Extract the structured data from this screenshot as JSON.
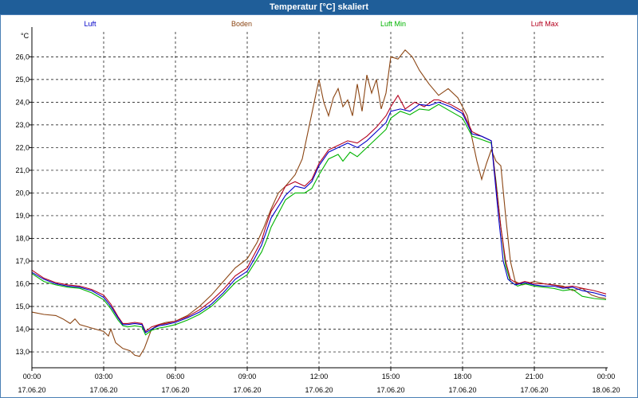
{
  "window": {
    "title": "Temperatur [°C] skaliert"
  },
  "chart_data": {
    "type": "line",
    "title": "Temperatur [°C] skaliert",
    "ylabel": "°C",
    "xlabel": "",
    "ylim": [
      12.3,
      27.1
    ],
    "xlim": [
      0,
      24
    ],
    "grid": true,
    "legend_position": "top",
    "y_ticks": [
      "13,0",
      "14,0",
      "15,0",
      "16,0",
      "17,0",
      "18,0",
      "19,0",
      "20,0",
      "21,0",
      "22,0",
      "23,0",
      "24,0",
      "25,0",
      "26,0"
    ],
    "x_ticks": [
      {
        "time": "00:00",
        "date": "17.06.20"
      },
      {
        "time": "03:00",
        "date": "17.06.20"
      },
      {
        "time": "06:00",
        "date": "17.06.20"
      },
      {
        "time": "09:00",
        "date": "17.06.20"
      },
      {
        "time": "12:00",
        "date": "17.06.20"
      },
      {
        "time": "15:00",
        "date": "17.06.20"
      },
      {
        "time": "18:00",
        "date": "17.06.20"
      },
      {
        "time": "21:00",
        "date": "17.06.20"
      },
      {
        "time": "00:00",
        "date": "18.06.20"
      }
    ],
    "series": [
      {
        "name": "Luft",
        "color": "#0000c8",
        "points": [
          [
            0,
            16.5
          ],
          [
            0.5,
            16.2
          ],
          [
            1,
            16.0
          ],
          [
            1.5,
            15.9
          ],
          [
            2,
            15.85
          ],
          [
            2.5,
            15.7
          ],
          [
            3,
            15.4
          ],
          [
            3.3,
            15.0
          ],
          [
            3.6,
            14.5
          ],
          [
            3.8,
            14.2
          ],
          [
            4,
            14.2
          ],
          [
            4.3,
            14.25
          ],
          [
            4.6,
            14.2
          ],
          [
            4.75,
            13.85
          ],
          [
            5,
            14.0
          ],
          [
            5.3,
            14.15
          ],
          [
            5.6,
            14.2
          ],
          [
            6,
            14.3
          ],
          [
            6.5,
            14.5
          ],
          [
            7,
            14.75
          ],
          [
            7.5,
            15.1
          ],
          [
            8,
            15.6
          ],
          [
            8.5,
            16.2
          ],
          [
            9,
            16.55
          ],
          [
            9.3,
            17.1
          ],
          [
            9.6,
            17.7
          ],
          [
            9.8,
            18.3
          ],
          [
            10,
            18.9
          ],
          [
            10.3,
            19.4
          ],
          [
            10.6,
            19.9
          ],
          [
            11,
            20.3
          ],
          [
            11.4,
            20.2
          ],
          [
            11.7,
            20.5
          ],
          [
            12,
            21.2
          ],
          [
            12.4,
            21.8
          ],
          [
            12.8,
            22.0
          ],
          [
            13.2,
            22.2
          ],
          [
            13.6,
            22.0
          ],
          [
            14,
            22.3
          ],
          [
            14.4,
            22.7
          ],
          [
            14.8,
            23.1
          ],
          [
            15,
            23.6
          ],
          [
            15.4,
            23.7
          ],
          [
            15.8,
            23.6
          ],
          [
            16.2,
            23.9
          ],
          [
            16.6,
            23.85
          ],
          [
            17,
            24.0
          ],
          [
            17.5,
            23.8
          ],
          [
            18,
            23.5
          ],
          [
            18.4,
            22.6
          ],
          [
            18.8,
            22.5
          ],
          [
            19.2,
            22.3
          ],
          [
            19.5,
            19.0
          ],
          [
            19.7,
            17.0
          ],
          [
            19.9,
            16.2
          ],
          [
            20.2,
            15.95
          ],
          [
            20.6,
            16.05
          ],
          [
            21,
            15.95
          ],
          [
            21.4,
            15.9
          ],
          [
            21.8,
            15.9
          ],
          [
            22.2,
            15.8
          ],
          [
            22.6,
            15.85
          ],
          [
            23,
            15.7
          ],
          [
            23.5,
            15.6
          ],
          [
            24,
            15.45
          ]
        ]
      },
      {
        "name": "Boden",
        "color": "#8b4513",
        "points": [
          [
            0,
            14.75
          ],
          [
            0.5,
            14.65
          ],
          [
            1,
            14.6
          ],
          [
            1.3,
            14.45
          ],
          [
            1.6,
            14.25
          ],
          [
            1.8,
            14.45
          ],
          [
            2,
            14.2
          ],
          [
            2.5,
            14.05
          ],
          [
            3,
            13.9
          ],
          [
            3.2,
            13.7
          ],
          [
            3.3,
            14.0
          ],
          [
            3.5,
            13.4
          ],
          [
            3.8,
            13.15
          ],
          [
            4.1,
            13.05
          ],
          [
            4.3,
            12.85
          ],
          [
            4.5,
            12.8
          ],
          [
            4.7,
            13.15
          ],
          [
            5,
            14.0
          ],
          [
            5.3,
            14.2
          ],
          [
            5.6,
            14.3
          ],
          [
            6,
            14.35
          ],
          [
            6.5,
            14.6
          ],
          [
            7,
            15.0
          ],
          [
            7.5,
            15.5
          ],
          [
            8,
            16.1
          ],
          [
            8.5,
            16.7
          ],
          [
            9,
            17.1
          ],
          [
            9.4,
            17.8
          ],
          [
            9.7,
            18.5
          ],
          [
            10,
            19.3
          ],
          [
            10.3,
            20.0
          ],
          [
            10.6,
            20.3
          ],
          [
            11,
            20.8
          ],
          [
            11.3,
            21.5
          ],
          [
            11.6,
            23.0
          ],
          [
            11.8,
            24.0
          ],
          [
            12,
            25.0
          ],
          [
            12.2,
            24.0
          ],
          [
            12.4,
            23.4
          ],
          [
            12.6,
            24.2
          ],
          [
            12.8,
            24.6
          ],
          [
            13,
            23.8
          ],
          [
            13.2,
            24.1
          ],
          [
            13.4,
            23.4
          ],
          [
            13.6,
            24.8
          ],
          [
            13.8,
            23.6
          ],
          [
            14,
            25.2
          ],
          [
            14.2,
            24.4
          ],
          [
            14.4,
            25.0
          ],
          [
            14.6,
            23.7
          ],
          [
            14.8,
            24.4
          ],
          [
            15,
            26.0
          ],
          [
            15.3,
            25.9
          ],
          [
            15.6,
            26.3
          ],
          [
            15.9,
            26.0
          ],
          [
            16.2,
            25.4
          ],
          [
            16.6,
            24.8
          ],
          [
            17,
            24.3
          ],
          [
            17.4,
            24.6
          ],
          [
            17.8,
            24.2
          ],
          [
            18,
            23.8
          ],
          [
            18.2,
            23.4
          ],
          [
            18.4,
            22.4
          ],
          [
            18.6,
            21.4
          ],
          [
            18.8,
            20.6
          ],
          [
            19,
            21.3
          ],
          [
            19.2,
            21.9
          ],
          [
            19.4,
            21.4
          ],
          [
            19.6,
            21.2
          ],
          [
            19.8,
            19.0
          ],
          [
            20,
            17.0
          ],
          [
            20.2,
            16.1
          ],
          [
            20.5,
            15.95
          ],
          [
            21,
            16.1
          ],
          [
            21.4,
            16.0
          ],
          [
            21.8,
            15.95
          ],
          [
            22.2,
            15.9
          ],
          [
            22.6,
            15.7
          ],
          [
            23,
            15.8
          ],
          [
            23.4,
            15.5
          ],
          [
            23.7,
            15.4
          ],
          [
            24,
            15.35
          ]
        ]
      },
      {
        "name": "Luft Min",
        "color": "#00b400",
        "points": [
          [
            0,
            16.45
          ],
          [
            0.5,
            16.1
          ],
          [
            1,
            15.95
          ],
          [
            1.5,
            15.85
          ],
          [
            2,
            15.8
          ],
          [
            2.5,
            15.6
          ],
          [
            3,
            15.3
          ],
          [
            3.3,
            14.9
          ],
          [
            3.6,
            14.4
          ],
          [
            3.8,
            14.15
          ],
          [
            4,
            14.1
          ],
          [
            4.3,
            14.15
          ],
          [
            4.6,
            14.1
          ],
          [
            4.75,
            13.75
          ],
          [
            5,
            13.95
          ],
          [
            5.3,
            14.05
          ],
          [
            5.6,
            14.1
          ],
          [
            6,
            14.2
          ],
          [
            6.5,
            14.4
          ],
          [
            7,
            14.65
          ],
          [
            7.5,
            15.0
          ],
          [
            8,
            15.5
          ],
          [
            8.5,
            16.05
          ],
          [
            9,
            16.4
          ],
          [
            9.3,
            16.9
          ],
          [
            9.6,
            17.4
          ],
          [
            9.8,
            17.9
          ],
          [
            10,
            18.5
          ],
          [
            10.3,
            19.1
          ],
          [
            10.6,
            19.7
          ],
          [
            11,
            20.0
          ],
          [
            11.4,
            20.0
          ],
          [
            11.7,
            20.2
          ],
          [
            12,
            20.8
          ],
          [
            12.4,
            21.5
          ],
          [
            12.8,
            21.7
          ],
          [
            13,
            21.4
          ],
          [
            13.3,
            21.8
          ],
          [
            13.6,
            21.6
          ],
          [
            14,
            22.0
          ],
          [
            14.4,
            22.4
          ],
          [
            14.8,
            22.8
          ],
          [
            15,
            23.3
          ],
          [
            15.4,
            23.6
          ],
          [
            15.8,
            23.45
          ],
          [
            16.2,
            23.7
          ],
          [
            16.6,
            23.65
          ],
          [
            17,
            23.9
          ],
          [
            17.5,
            23.6
          ],
          [
            18,
            23.3
          ],
          [
            18.4,
            22.5
          ],
          [
            18.8,
            22.35
          ],
          [
            19.2,
            22.2
          ],
          [
            19.4,
            20.5
          ],
          [
            19.6,
            18.5
          ],
          [
            19.8,
            16.8
          ],
          [
            20,
            16.1
          ],
          [
            20.3,
            15.9
          ],
          [
            20.6,
            16.0
          ],
          [
            21,
            15.9
          ],
          [
            21.4,
            15.85
          ],
          [
            21.8,
            15.8
          ],
          [
            22.2,
            15.7
          ],
          [
            22.6,
            15.75
          ],
          [
            23,
            15.45
          ],
          [
            23.5,
            15.35
          ],
          [
            24,
            15.3
          ]
        ]
      },
      {
        "name": "Luft Max",
        "color": "#b4001e",
        "points": [
          [
            0,
            16.6
          ],
          [
            0.5,
            16.25
          ],
          [
            1,
            16.05
          ],
          [
            1.5,
            15.95
          ],
          [
            2,
            15.9
          ],
          [
            2.5,
            15.75
          ],
          [
            3,
            15.5
          ],
          [
            3.3,
            15.1
          ],
          [
            3.6,
            14.55
          ],
          [
            3.8,
            14.25
          ],
          [
            4,
            14.25
          ],
          [
            4.3,
            14.3
          ],
          [
            4.6,
            14.25
          ],
          [
            4.75,
            13.9
          ],
          [
            5,
            14.1
          ],
          [
            5.3,
            14.2
          ],
          [
            5.6,
            14.25
          ],
          [
            6,
            14.35
          ],
          [
            6.5,
            14.55
          ],
          [
            7,
            14.85
          ],
          [
            7.5,
            15.25
          ],
          [
            8,
            15.75
          ],
          [
            8.5,
            16.35
          ],
          [
            9,
            16.7
          ],
          [
            9.3,
            17.3
          ],
          [
            9.6,
            17.9
          ],
          [
            9.8,
            18.6
          ],
          [
            10,
            19.2
          ],
          [
            10.3,
            19.7
          ],
          [
            10.6,
            20.3
          ],
          [
            11,
            20.5
          ],
          [
            11.4,
            20.3
          ],
          [
            11.7,
            20.6
          ],
          [
            12,
            21.3
          ],
          [
            12.4,
            21.9
          ],
          [
            12.8,
            22.1
          ],
          [
            13.2,
            22.3
          ],
          [
            13.6,
            22.2
          ],
          [
            14,
            22.5
          ],
          [
            14.4,
            22.9
          ],
          [
            14.8,
            23.4
          ],
          [
            15,
            23.8
          ],
          [
            15.3,
            24.3
          ],
          [
            15.6,
            23.7
          ],
          [
            16,
            24.0
          ],
          [
            16.4,
            23.8
          ],
          [
            16.8,
            24.1
          ],
          [
            17,
            24.1
          ],
          [
            17.5,
            23.9
          ],
          [
            18,
            23.6
          ],
          [
            18.4,
            22.7
          ],
          [
            18.8,
            22.5
          ],
          [
            19.2,
            22.3
          ],
          [
            19.6,
            18.5
          ],
          [
            19.8,
            17.0
          ],
          [
            20,
            16.2
          ],
          [
            20.3,
            16.0
          ],
          [
            20.6,
            16.1
          ],
          [
            21,
            16.0
          ],
          [
            21.4,
            16.0
          ],
          [
            21.8,
            15.95
          ],
          [
            22.2,
            15.85
          ],
          [
            22.6,
            15.9
          ],
          [
            23,
            15.8
          ],
          [
            23.5,
            15.7
          ],
          [
            24,
            15.55
          ]
        ]
      }
    ]
  }
}
